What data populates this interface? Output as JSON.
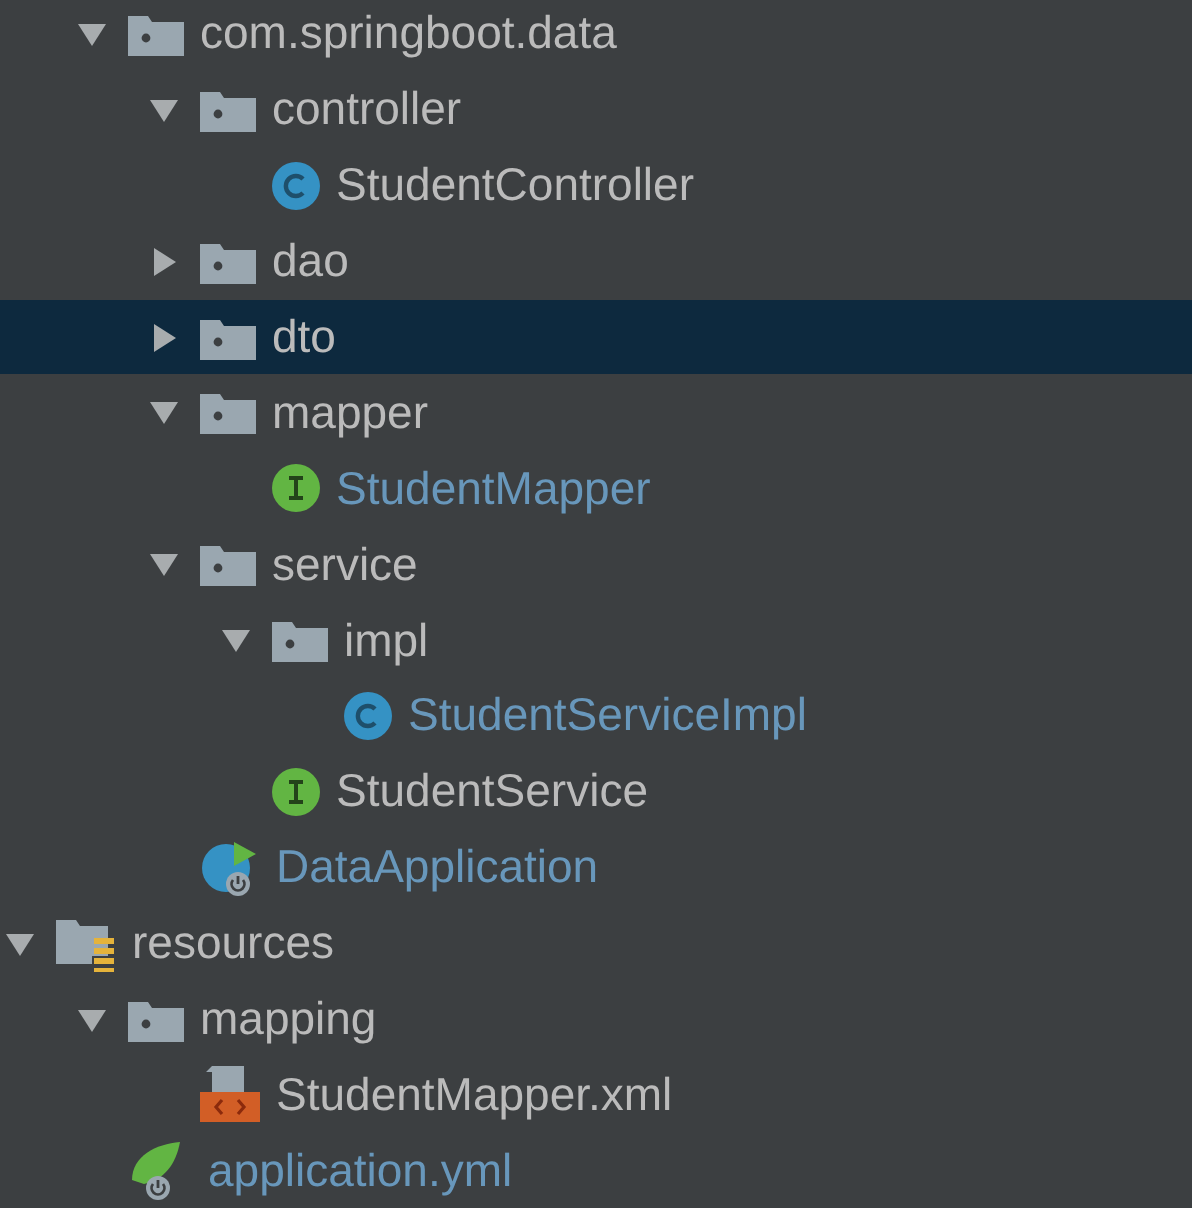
{
  "project_tree": {
    "items": [
      {
        "children": [
          {
            "name": "com.springboot.data",
            "kind": "package",
            "expanded": true,
            "selected": false,
            "modified": false,
            "children": [
              {
                "name": "controller",
                "kind": "package",
                "expanded": true,
                "selected": false,
                "modified": false,
                "children": [
                  {
                    "name": "StudentController",
                    "kind": "class",
                    "selected": false,
                    "modified": false
                  }
                ]
              },
              {
                "name": "dao",
                "kind": "package",
                "expanded": false,
                "selected": false,
                "modified": false
              },
              {
                "name": "dto",
                "kind": "package",
                "expanded": false,
                "selected": true,
                "modified": false
              },
              {
                "name": "mapper",
                "kind": "package",
                "expanded": true,
                "selected": false,
                "modified": false,
                "children": [
                  {
                    "name": "StudentMapper",
                    "kind": "interface",
                    "selected": false,
                    "modified": true
                  }
                ]
              },
              {
                "name": "service",
                "kind": "package",
                "expanded": true,
                "selected": false,
                "modified": false,
                "children": [
                  {
                    "name": "impl",
                    "kind": "package",
                    "expanded": true,
                    "selected": false,
                    "modified": false,
                    "children": [
                      {
                        "name": "StudentServiceImpl",
                        "kind": "class",
                        "selected": false,
                        "modified": true
                      }
                    ]
                  },
                  {
                    "name": "StudentService",
                    "kind": "interface",
                    "selected": false,
                    "modified": false
                  }
                ]
              },
              {
                "name": "DataApplication",
                "kind": "spring-app",
                "selected": false,
                "modified": true
              }
            ]
          }
        ]
      },
      {
        "name": "resources",
        "kind": "resources",
        "expanded": true,
        "selected": false,
        "modified": false,
        "children": [
          {
            "name": "mapping",
            "kind": "package",
            "expanded": true,
            "selected": false,
            "modified": false,
            "children": [
              {
                "name": "StudentMapper.xml",
                "kind": "xml",
                "selected": false,
                "modified": false
              }
            ]
          },
          {
            "name": "application.yml",
            "kind": "yml",
            "selected": false,
            "modified": true
          }
        ]
      }
    ]
  }
}
